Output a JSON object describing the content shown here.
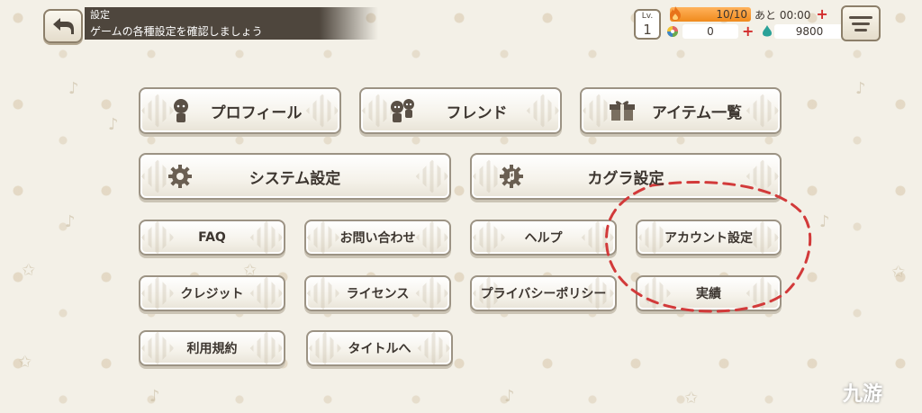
{
  "header": {
    "title": "設定",
    "subtitle": "ゲームの各種設定を確認しましょう"
  },
  "status": {
    "level_label": "Lv.",
    "level": "1",
    "stamina": "10/10",
    "stamina_fraction": 1.0,
    "timer": "あと 00:00",
    "gems": "0",
    "currency": "9800"
  },
  "menu": {
    "profile": "プロフィール",
    "friend": "フレンド",
    "items": "アイテム一覧",
    "system_settings": "システム設定",
    "kagura_settings": "カグラ設定",
    "faq": "FAQ",
    "contact": "お問い合わせ",
    "help": "ヘルプ",
    "account_settings": "アカウント設定",
    "credits": "クレジット",
    "license": "ライセンス",
    "privacy_policy": "プライバシーポリシー",
    "achievements": "実績",
    "terms": "利用規約",
    "to_title": "タイトルへ"
  },
  "watermark": "九游",
  "colors": {
    "accent_orange": "#f08a1c",
    "plus_red": "#d22c2c",
    "header_bar": "#4e463d",
    "annotation_red": "#d23a3a"
  }
}
